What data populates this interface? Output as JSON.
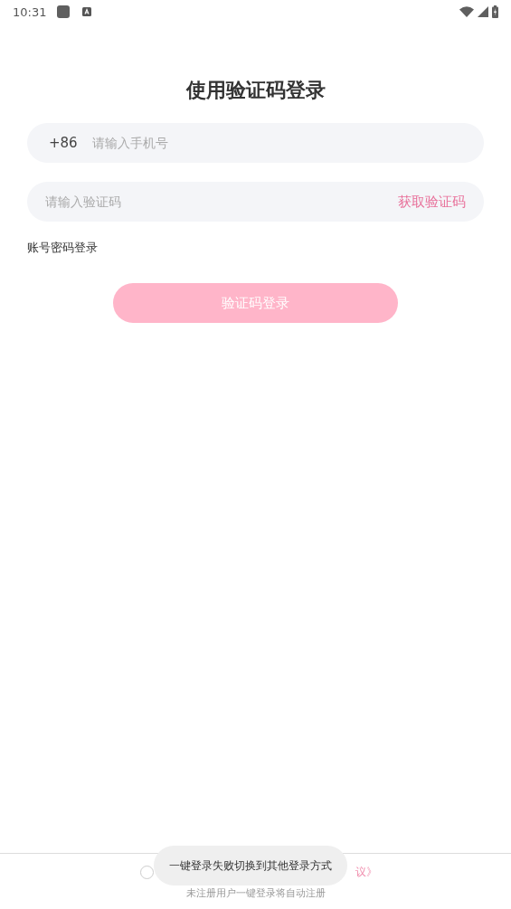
{
  "status_bar": {
    "time": "10:31"
  },
  "title": "使用验证码登录",
  "phone_field": {
    "prefix": "+86",
    "placeholder": "请输入手机号"
  },
  "code_field": {
    "placeholder": "请输入验证码",
    "action": "获取验证码"
  },
  "alt_login_link": "账号密码登录",
  "login_button": {
    "label": "验证码登录",
    "disabled": true
  },
  "agreement": {
    "checked": false,
    "link_tail": "议》"
  },
  "register_hint": "未注册用户一键登录将自动注册",
  "toast": "一键登录失败切换到其他登录方式"
}
